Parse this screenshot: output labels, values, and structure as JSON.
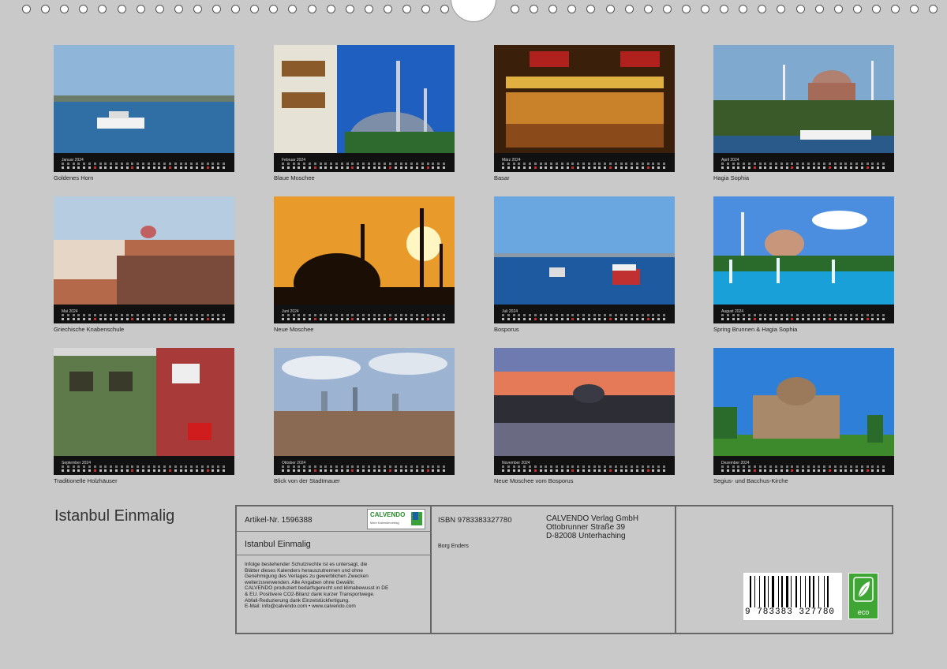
{
  "ring_count_left": 23,
  "ring_count_right": 23,
  "months": [
    {
      "month": "Januar 2024",
      "caption": "Goldenes Horn",
      "scene": "harbor"
    },
    {
      "month": "Februar 2024",
      "caption": "Blaue Moschee",
      "scene": "bluemosque"
    },
    {
      "month": "März 2024",
      "caption": "Basar",
      "scene": "bazaar"
    },
    {
      "month": "April 2024",
      "caption": "Hagia Sophia",
      "scene": "hagia"
    },
    {
      "month": "Mai 2024",
      "caption": "Griechische Knabenschule",
      "scene": "school"
    },
    {
      "month": "Juni 2024",
      "caption": "Neue Moschee",
      "scene": "sunset"
    },
    {
      "month": "Juli 2024",
      "caption": "Bosporus",
      "scene": "bosporus"
    },
    {
      "month": "August 2024",
      "caption": "Spring Brunnen & Hagia Sophia",
      "scene": "fountain"
    },
    {
      "month": "September 2024",
      "caption": "Traditionelle Holzhäuser",
      "scene": "houses"
    },
    {
      "month": "Oktober 2024",
      "caption": "Blick von der Stadtmauer",
      "scene": "skyline"
    },
    {
      "month": "November 2024",
      "caption": "Neue Moschee vom Bosporus",
      "scene": "dusk"
    },
    {
      "month": "Dezember 2024",
      "caption": "Segius- und Bacchus-Kirche",
      "scene": "church"
    }
  ],
  "cover_title": "Istanbul Einmalig",
  "panel": {
    "article": "Artikel-Nr. 1596388",
    "logo_name": "CALVENDO",
    "logo_sub": "Mein Kalenderverlag",
    "subtitle": "Istanbul Einmalig",
    "legal": [
      "Infolge bestehender Schutzrechte ist es untersagt, die",
      "Blätter dieses Kalenders herauszutrennen und ohne",
      "Genehmigung des Verlages zu gewerblichen Zwecken",
      "weiterzuverwenden. Alle Angaben ohne Gewähr.",
      "CALVENDO produziert bedarfsgerecht und klimabewusst in DE",
      "& EU. Positivere CO2-Bilanz dank kurzer Transportwege.",
      "Abfall-Reduzierung dank Einzelstückfertigung.",
      "E-Mail: info@calvendo.com • www.calvendo.com"
    ],
    "isbn": "ISBN 9783383327780",
    "author": "Borg Enders",
    "publisher": [
      "CALVENDO Verlag GmbH",
      "Ottobrunner Straße 39",
      "D-82008 Unterhaching"
    ],
    "barcode_number": "9 783383 327780",
    "eco_label": "eco"
  }
}
